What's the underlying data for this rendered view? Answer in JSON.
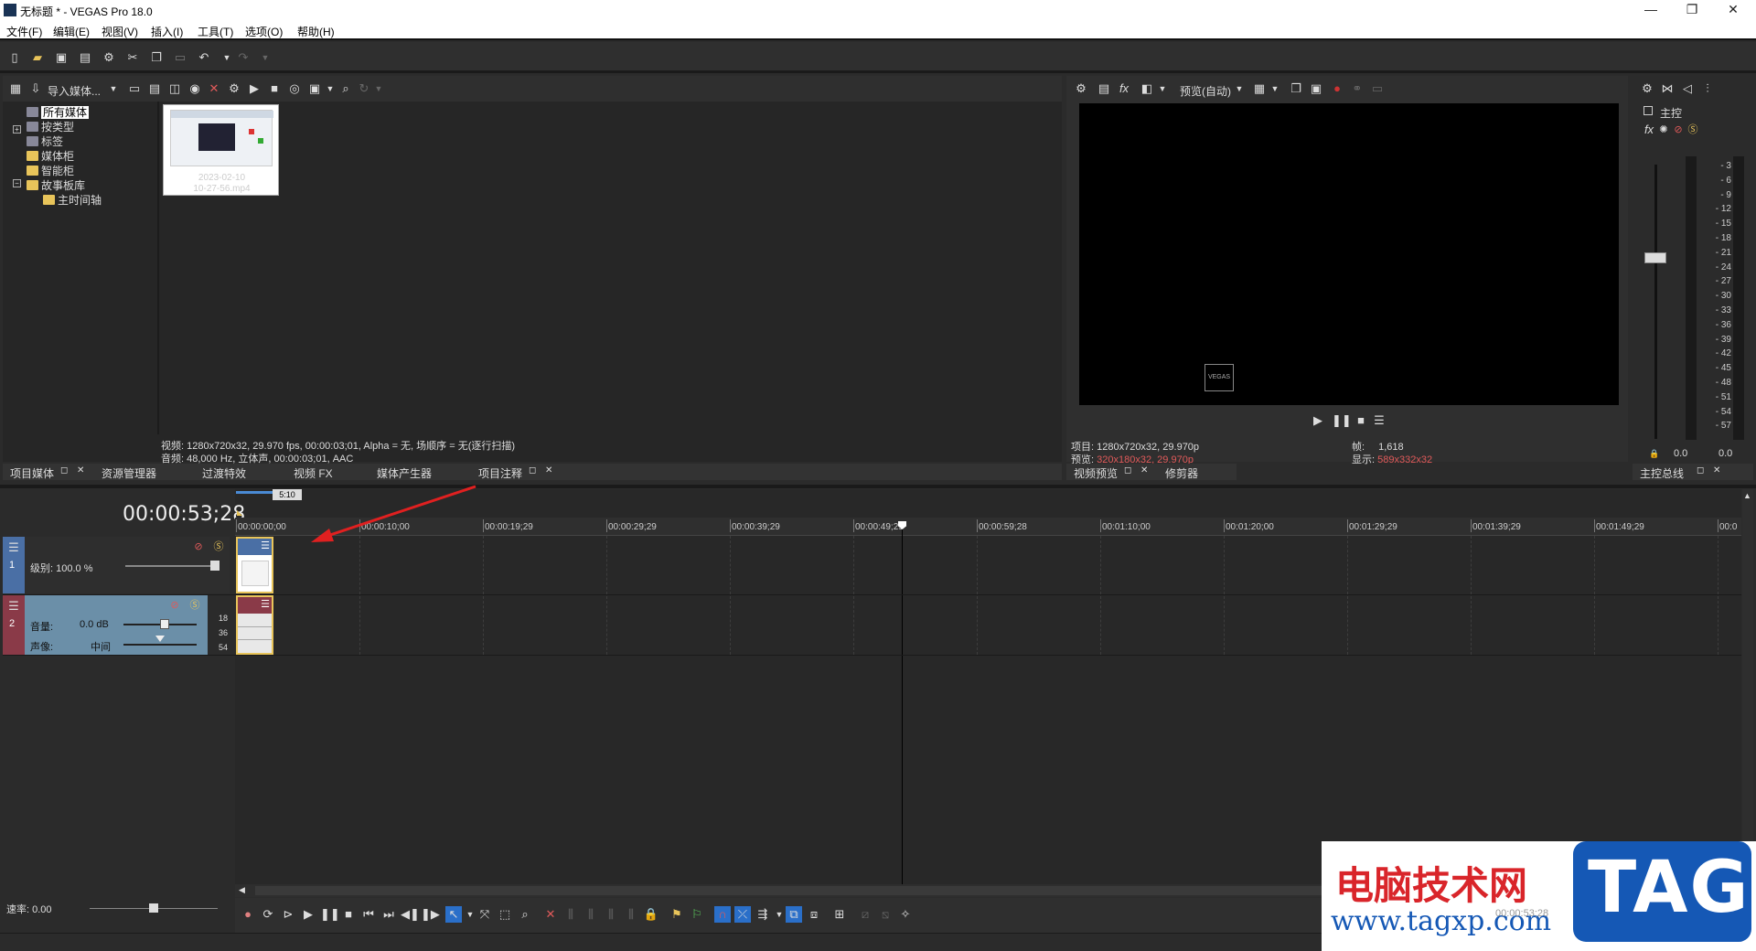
{
  "window": {
    "title": "无标题 * - VEGAS Pro 18.0",
    "minimize": "—",
    "maximize": "❐",
    "close": "✕"
  },
  "menu": [
    "文件(F)",
    "编辑(E)",
    "视图(V)",
    "插入(I)",
    "工具(T)",
    "选项(O)",
    "帮助(H)"
  ],
  "media_panel": {
    "import_label": "导入媒体...",
    "tree": [
      "所有媒体",
      "按类型",
      "标签",
      "媒体柜",
      "智能柜",
      "故事板库",
      "主时间轴"
    ],
    "thumb_caption_line1": "2023-02-10",
    "thumb_caption_line2": "10-27-56.mp4",
    "info_video": "视频: 1280x720x32, 29.970 fps, 00:00:03;01, Alpha = 无, 场顺序 = 无(逐行扫描)",
    "info_audio": "音频: 48,000 Hz, 立体声, 00:00:03;01, AAC",
    "tabs": [
      "项目媒体",
      "资源管理器",
      "过渡特效",
      "视频 FX",
      "媒体产生器",
      "项目注释"
    ]
  },
  "preview_panel": {
    "mode_label": "预览(自动)",
    "logo_text": "VEGAS",
    "project_info": "项目: 1280x720x32, 29.970p",
    "preview_label": "预览:",
    "preview_value": "320x180x32, 29.970p",
    "frame_label": "帧:",
    "frame_value": "1,618",
    "display_label": "显示:",
    "display_value": "589x332x32",
    "tabs": [
      "视频预览",
      "修剪器"
    ]
  },
  "master_panel": {
    "title": "主控",
    "meter_scale": [
      "3",
      "6",
      "9",
      "12",
      "15",
      "18",
      "21",
      "24",
      "27",
      "30",
      "33",
      "36",
      "39",
      "42",
      "45",
      "48",
      "51",
      "54",
      "57"
    ],
    "left_value": "0.0",
    "right_value": "0.0",
    "tab": "主控总线"
  },
  "timeline": {
    "timecode": "00:00:53;28",
    "loop_marker": "5:10",
    "ruler": [
      "00:00:00;00",
      "00:00:10;00",
      "00:00:19;29",
      "00:00:29;29",
      "00:00:39;29",
      "00:00:49;29",
      "00:00:59;28",
      "00:01:10;00",
      "00:01:20;00",
      "00:01:29;29",
      "00:01:39;29",
      "00:01:49;29",
      "00:0"
    ],
    "video_track": {
      "number": "1",
      "level_label": "级别: 100.0 %"
    },
    "audio_track": {
      "number": "2",
      "volume_label": "音量:",
      "volume_value": "0.0 dB",
      "pan_label": "声像:",
      "pan_value": "中间",
      "scale": [
        "18",
        "36",
        "54"
      ]
    },
    "rate_label": "速率: 0.00",
    "bottom_timecode": "00:00:53;28"
  },
  "watermark": {
    "brand": "电脑技术网",
    "url": "www.tagxp.com",
    "tag": "TAG"
  },
  "colors": {
    "video_track": "#4a6fa5",
    "audio_track": "#8a3a48",
    "accent_red": "#e05a5a"
  }
}
